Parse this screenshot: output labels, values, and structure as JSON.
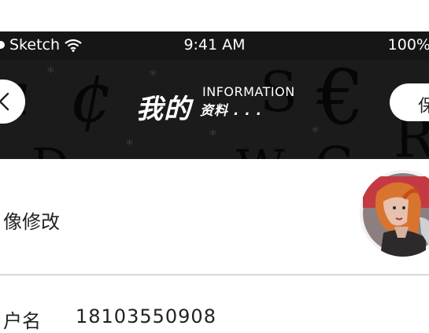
{
  "status_bar": {
    "carrier": "Sketch",
    "time": "9:41 AM",
    "battery": "100%",
    "wifi_icon": "wifi-icon"
  },
  "header": {
    "title_cn": "我的",
    "title_en": "INFORMATION",
    "title_sub": "资料 . . .",
    "back_icon": "chevron-left-icon",
    "save_label": "保",
    "decor": [
      "a",
      "*",
      "¢",
      "S",
      "€",
      "R",
      "*",
      "*",
      "*",
      "D",
      "W",
      "C",
      "*"
    ]
  },
  "avatar_row": {
    "label": "像修改"
  },
  "user_row": {
    "label": "户名",
    "value": "18103550908"
  }
}
